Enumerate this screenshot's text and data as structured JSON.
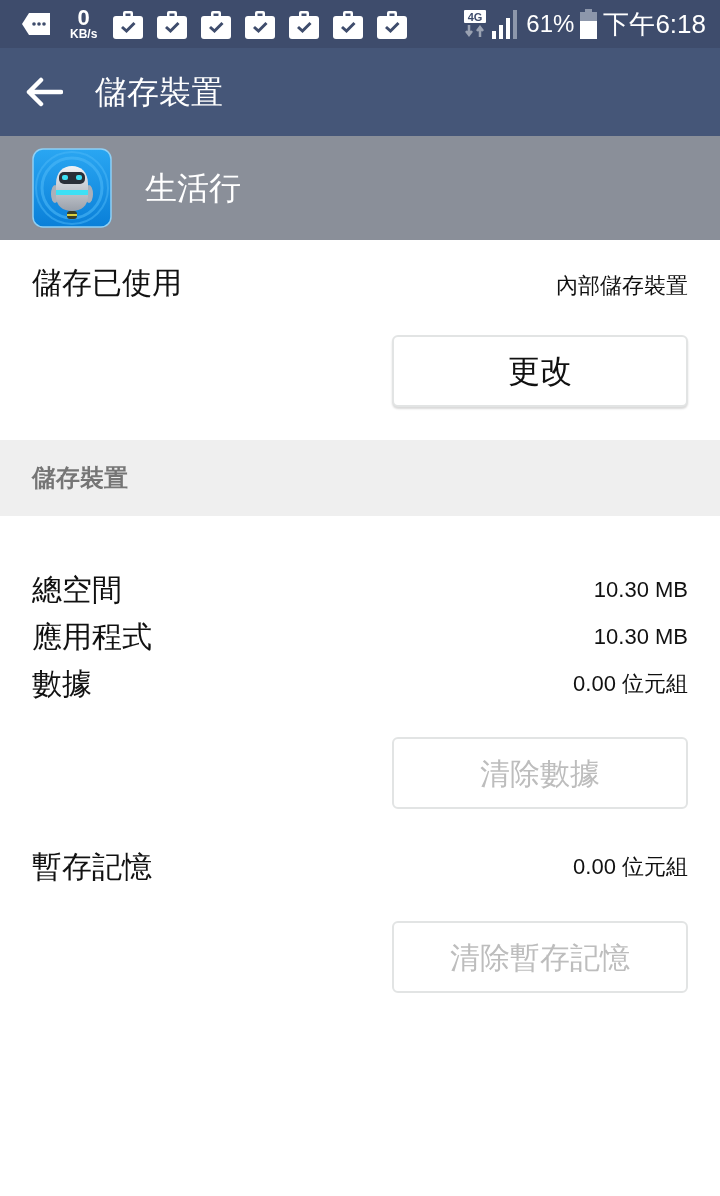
{
  "status_bar": {
    "notifications": [
      {
        "kind": "chat"
      },
      {
        "kind": "speed",
        "value": "0",
        "unit": "KB/s"
      },
      {
        "kind": "task"
      },
      {
        "kind": "task"
      },
      {
        "kind": "task"
      },
      {
        "kind": "task"
      },
      {
        "kind": "task"
      },
      {
        "kind": "task"
      },
      {
        "kind": "task"
      }
    ],
    "network_type": "4G",
    "battery": "61%",
    "time": "下午6:18"
  },
  "app_bar": {
    "title": "儲存裝置"
  },
  "app_header": {
    "name": "生活行"
  },
  "storage_used": {
    "label": "儲存已使用",
    "location": "內部儲存裝置",
    "button": {
      "label": "更改",
      "disabled": false
    }
  },
  "storage_section": {
    "header": "儲存裝置",
    "rows": [
      {
        "label": "總空間",
        "value": "10.30 MB"
      },
      {
        "label": "應用程式",
        "value": "10.30 MB"
      },
      {
        "label": "數據",
        "value": "0.00 位元組"
      }
    ],
    "button": {
      "label": "清除數據",
      "disabled": true
    }
  },
  "cache_section": {
    "label": "暫存記憶",
    "value": "0.00 位元組",
    "button": {
      "label": "清除暫存記憶",
      "disabled": true
    }
  }
}
